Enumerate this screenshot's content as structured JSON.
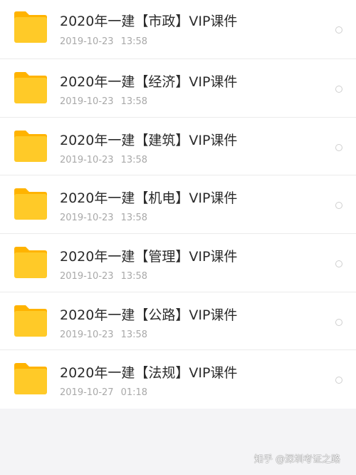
{
  "colors": {
    "folder": "#FFCA28",
    "folder_tab": "#FFB300",
    "title": "#2B2B2B",
    "meta": "#A9A9A9",
    "background": "#F4F4F6"
  },
  "files": [
    {
      "icon": "folder-icon",
      "name": "2020年一建【市政】VIP课件",
      "date": "2019-10-23",
      "time": "13:58"
    },
    {
      "icon": "folder-icon",
      "name": "2020年一建【经济】VIP课件",
      "date": "2019-10-23",
      "time": "13:58"
    },
    {
      "icon": "folder-icon",
      "name": "2020年一建【建筑】VIP课件",
      "date": "2019-10-23",
      "time": "13:58"
    },
    {
      "icon": "folder-icon",
      "name": "2020年一建【机电】VIP课件",
      "date": "2019-10-23",
      "time": "13:58"
    },
    {
      "icon": "folder-icon",
      "name": "2020年一建【管理】VIP课件",
      "date": "2019-10-23",
      "time": "13:58"
    },
    {
      "icon": "folder-icon",
      "name": "2020年一建【公路】VIP课件",
      "date": "2019-10-23",
      "time": "13:58"
    },
    {
      "icon": "folder-icon",
      "name": "2020年一建【法规】VIP课件",
      "date": "2019-10-27",
      "time": "01:18"
    }
  ],
  "watermark": "知乎 @深圳考证之路"
}
